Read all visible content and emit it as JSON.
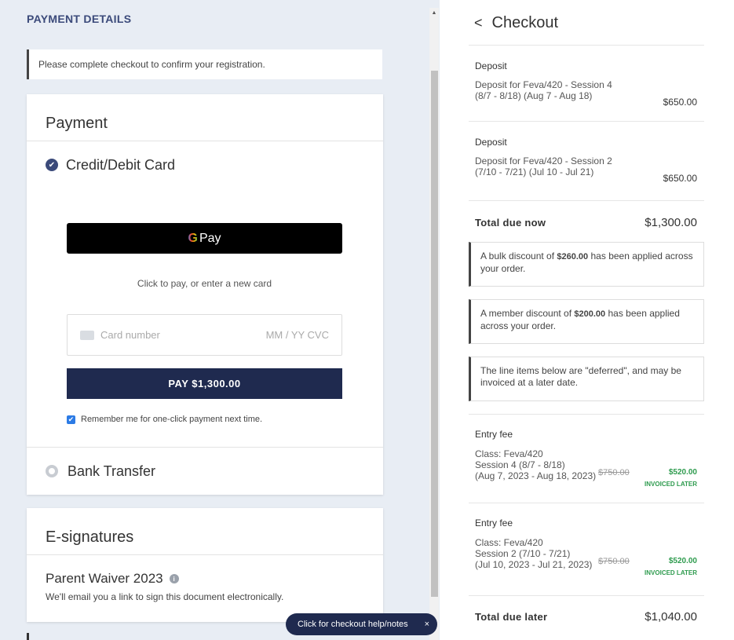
{
  "left": {
    "section_title": "PAYMENT DETAILS",
    "notice": "Please complete checkout to confirm your registration.",
    "payment": {
      "heading": "Payment",
      "credit_method": "Credit/Debit Card",
      "gpay_label": "Pay",
      "gpay_g": "G",
      "click_to_pay": "Click to pay, or enter a new card",
      "card_number_placeholder": "Card number",
      "card_expiry_cvc": "MM / YY  CVC",
      "pay_button": "PAY $1,300.00",
      "remember_label": "Remember me for one-click payment next time.",
      "bank_method": "Bank Transfer"
    },
    "esig": {
      "heading": "E-signatures",
      "waiver_title": "Parent Waiver 2023",
      "waiver_desc": "We'll email you a link to sign this document electronically."
    },
    "help_pill": "Click for checkout help/notes",
    "help_close": "×"
  },
  "right": {
    "title": "Checkout",
    "items": [
      {
        "title": "Deposit",
        "desc_line1": "Deposit for Feva/420 - Session 4",
        "desc_line2": "(8/7 - 8/18) (Aug 7 - Aug 18)",
        "amount": "$650.00"
      },
      {
        "title": "Deposit",
        "desc_line1": "Deposit for Feva/420 - Session 2",
        "desc_line2": "(7/10 - 7/21) (Jul 10 - Jul 21)",
        "amount": "$650.00"
      }
    ],
    "total_now_label": "Total due now",
    "total_now_value": "$1,300.00",
    "discounts": [
      {
        "pre": "A bulk discount of ",
        "amount": "$260.00",
        "post": " has been applied across your order."
      },
      {
        "pre": "A member discount of ",
        "amount": "$200.00",
        "post": " has been applied across your order."
      }
    ],
    "deferred_note": "The line items below are \"deferred\", and may be invoiced at a later date.",
    "deferred_items": [
      {
        "title": "Entry fee",
        "line1": "Class: Feva/420",
        "line2": "Session 4 (8/7 - 8/18)",
        "line3": "(Aug 7, 2023 - Aug 18, 2023)",
        "original": "$750.00",
        "amount": "$520.00",
        "status": "INVOICED LATER"
      },
      {
        "title": "Entry fee",
        "line1": "Class: Feva/420",
        "line2": "Session 2 (7/10 - 7/21)",
        "line3": "(Jul 10, 2023 - Jul 21, 2023)",
        "original": "$750.00",
        "amount": "$520.00",
        "status": "INVOICED LATER"
      }
    ],
    "total_later_label": "Total due later",
    "total_later_value": "$1,040.00"
  },
  "colors": {
    "accent": "#3b4a7a",
    "pay_button": "#1f2a4f",
    "green": "#2e9b4e",
    "panel_bg": "#e8edf4"
  }
}
